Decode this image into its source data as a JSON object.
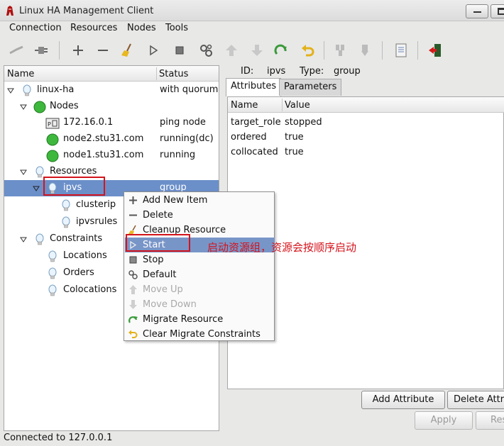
{
  "window": {
    "title": "Linux HA Management Client"
  },
  "menubar": [
    "Connection",
    "Resources",
    "Nodes",
    "Tools"
  ],
  "toolbar": [
    {
      "icon": "disconnect-icon"
    },
    {
      "icon": "connect-icon"
    },
    {
      "icon": "add-icon"
    },
    {
      "icon": "remove-icon"
    },
    {
      "icon": "broom-cleanup-icon"
    },
    {
      "icon": "start-icon"
    },
    {
      "icon": "stop-icon"
    },
    {
      "icon": "default-gears-icon"
    },
    {
      "icon": "move-up-icon"
    },
    {
      "icon": "move-down-icon"
    },
    {
      "icon": "migrate-icon"
    },
    {
      "icon": "clear-migrate-icon"
    },
    {
      "icon": "standby-icon"
    },
    {
      "icon": "active-icon"
    },
    {
      "icon": "document-icon"
    },
    {
      "icon": "exit-icon"
    }
  ],
  "tree": {
    "columns": {
      "name": "Name",
      "status": "Status"
    },
    "rows": [
      {
        "label": "linux-ha",
        "status": "with quorum",
        "icon": "bulb-icon"
      },
      {
        "label": "Nodes",
        "status": "",
        "icon": "green-dot-icon"
      },
      {
        "label": "172.16.0.1",
        "status": "ping node",
        "icon": "ping-node-icon"
      },
      {
        "label": "node2.stu31.com",
        "status": "running(dc)",
        "icon": "green-dot-icon"
      },
      {
        "label": "node1.stu31.com",
        "status": "running",
        "icon": "green-dot-icon"
      },
      {
        "label": "Resources",
        "status": "",
        "icon": "bulb-icon"
      },
      {
        "label": "ipvs",
        "status": "group",
        "icon": "bulb-icon"
      },
      {
        "label": "clusterip",
        "status": "",
        "icon": "bulb-icon"
      },
      {
        "label": "ipvsrules",
        "status": "",
        "icon": "bulb-icon"
      },
      {
        "label": "Constraints",
        "status": "",
        "icon": "bulb-icon"
      },
      {
        "label": "Locations",
        "status": "",
        "icon": "bulb-icon"
      },
      {
        "label": "Orders",
        "status": "",
        "icon": "bulb-icon"
      },
      {
        "label": "Colocations",
        "status": "",
        "icon": "bulb-icon"
      }
    ]
  },
  "detail": {
    "id_label": "ID:",
    "id_value": "ipvs",
    "type_label": "Type:",
    "type_value": "group",
    "tabs": [
      "Attributes",
      "Parameters"
    ],
    "columns": {
      "name": "Name",
      "value": "Value"
    },
    "attributes": [
      {
        "name": "target_role",
        "value": "stopped"
      },
      {
        "name": "ordered",
        "value": "true"
      },
      {
        "name": "collocated",
        "value": "true"
      }
    ],
    "buttons": {
      "add_attribute": "Add Attribute",
      "delete_attribute": "Delete Attri",
      "apply": "Apply",
      "reset": "Res"
    }
  },
  "context_menu": [
    {
      "label": "Add New Item",
      "icon": "plus-icon",
      "enabled": true
    },
    {
      "label": "Delete",
      "icon": "minus-icon",
      "enabled": true
    },
    {
      "label": "Cleanup Resource",
      "icon": "broom-icon",
      "enabled": true
    },
    {
      "label": "Start",
      "icon": "play-icon",
      "enabled": true,
      "highlighted": true
    },
    {
      "label": "Stop",
      "icon": "stop-square-icon",
      "enabled": true
    },
    {
      "label": "Default",
      "icon": "gears-icon",
      "enabled": true
    },
    {
      "label": "Move Up",
      "icon": "arrow-up-icon",
      "enabled": false
    },
    {
      "label": "Move Down",
      "icon": "arrow-down-icon",
      "enabled": false
    },
    {
      "label": "Migrate Resource",
      "icon": "migrate-arrow-icon",
      "enabled": true
    },
    {
      "label": "Clear Migrate Constraints",
      "icon": "undo-arrow-icon",
      "enabled": true
    }
  ],
  "annotation": "启动资源组，资源会按顺序启动",
  "statusbar": "Connected to 127.0.0.1",
  "colors": {
    "selection": "#6b8fc9",
    "menu_highlight": "#7895c8",
    "annotation_red": "#d4141c"
  }
}
